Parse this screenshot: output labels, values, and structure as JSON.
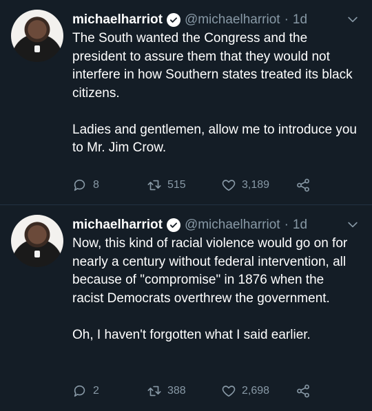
{
  "tweets": [
    {
      "author_name": "michaelharriot",
      "handle": "@michaelharriot",
      "separator": "·",
      "time": "1d",
      "paragraphs": [
        "The South wanted the Congress and the president to assure them that they would not interfere in how Southern states treated its black citizens.",
        "Ladies and gentlemen, allow me to introduce you to Mr. Jim Crow."
      ],
      "replies": "8",
      "retweets": "515",
      "likes": "3,189"
    },
    {
      "author_name": "michaelharriot",
      "handle": "@michaelharriot",
      "separator": "·",
      "time": "1d",
      "paragraphs": [
        "Now, this kind of racial violence would go on for nearly a century without federal intervention, all because of \"compromise\" in 1876 when the racist Democrats overthrew the government.",
        "Oh, I haven't forgotten what I said earlier."
      ],
      "replies": "2",
      "retweets": "388",
      "likes": "2,698"
    }
  ],
  "colors": {
    "background": "#141d26",
    "text": "#ffffff",
    "muted": "#8899a6"
  }
}
